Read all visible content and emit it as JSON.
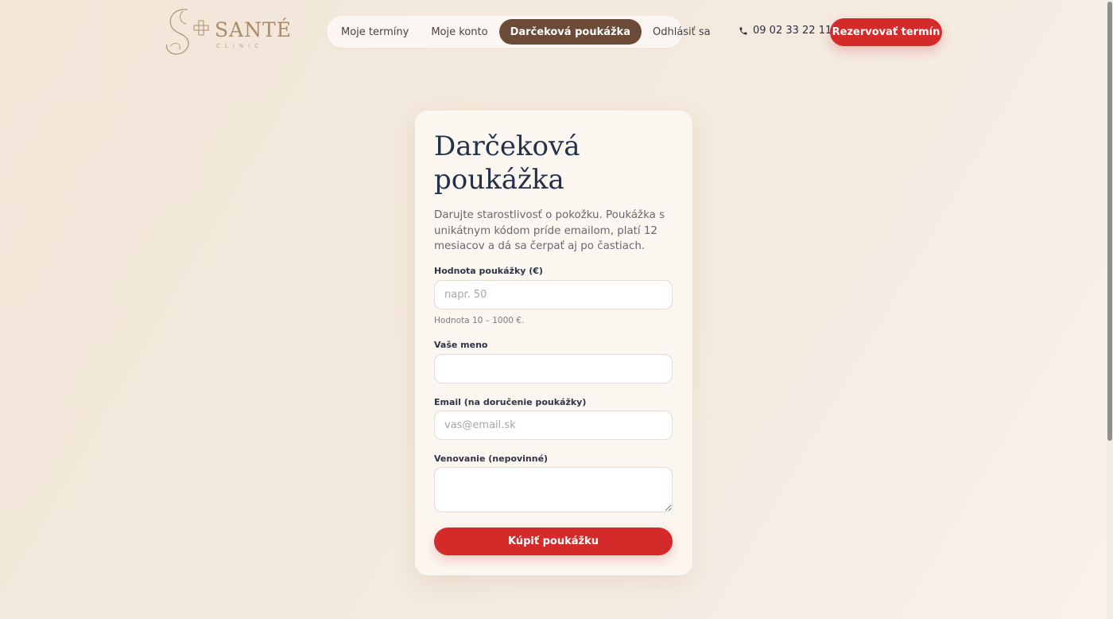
{
  "brand": {
    "name": "SANTÉ",
    "sub": "CLINIC"
  },
  "nav": {
    "items": [
      {
        "label": "Moje termíny"
      },
      {
        "label": "Moje konto"
      },
      {
        "label": "Darčeková poukážka",
        "active": true
      },
      {
        "label": "Odhlásiť sa"
      }
    ]
  },
  "header": {
    "phone": "09 02 33 22 11",
    "cta_label": "Rezervovať termín"
  },
  "form": {
    "title": "Darčeková poukážka",
    "intro": "Darujte starostlivosť o pokožku. Poukážka s unikátnym kódom príde emailom, platí 12 mesiacov a dá sa čerpať aj po častiach.",
    "amount_label": "Hodnota poukážky (€)",
    "amount_placeholder": "napr. 50",
    "amount_value": "",
    "amount_hint": "Hodnota 10 – 1000 €.",
    "name_label": "Vaše meno",
    "name_value": "",
    "email_label": "Email (na doručenie poukážky)",
    "email_placeholder": "vas@email.sk",
    "email_value": "",
    "dedication_label": "Venovanie (nepovinné)",
    "dedication_value": "",
    "submit_label": "Kúpiť poukážku"
  },
  "colors": {
    "accent": "#d52a2a",
    "nav_active": "#6b4a37",
    "brand": "#a98b67",
    "title": "#25304a"
  },
  "icons": {
    "phone": "phone-icon",
    "logo": "face-cross-logo-icon"
  }
}
